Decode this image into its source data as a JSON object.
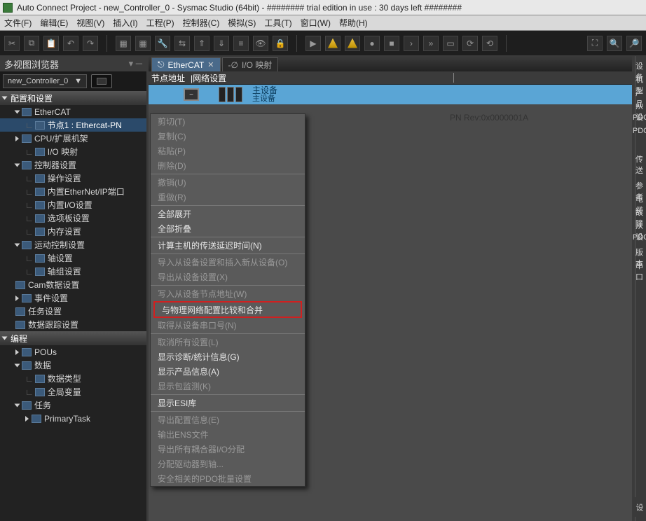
{
  "title": "Auto Connect Project - new_Controller_0 - Sysmac Studio (64bit) - ######## trial edition in use : 30 days left ########",
  "menu": {
    "file": "文件(F)",
    "edit": "编辑(E)",
    "view": "视图(V)",
    "insert": "插入(I)",
    "project": "工程(P)",
    "controller": "控制器(C)",
    "sim": "模拟(S)",
    "tool": "工具(T)",
    "window": "窗口(W)",
    "help": "帮助(H)"
  },
  "leftPane": {
    "title": "多视图浏览器",
    "dash": "▾",
    "controller": "new_Controller_0"
  },
  "tree": {
    "g1": "配置和设置",
    "items": [
      {
        "ind": 14,
        "tri": "d",
        "ico": 1,
        "label": "EtherCAT"
      },
      {
        "ind": 28,
        "tri": "",
        "ico": 1,
        "label": "节点1 : Ethercat-PN",
        "sel": true,
        "pipe": 1
      },
      {
        "ind": 14,
        "tri": "r",
        "ico": 1,
        "label": "CPU/扩展机架"
      },
      {
        "ind": 28,
        "tri": "",
        "ico": 1,
        "label": "I/O 映射",
        "pipe": 1
      },
      {
        "ind": 14,
        "tri": "d",
        "ico": 1,
        "label": "控制器设置"
      },
      {
        "ind": 28,
        "tri": "",
        "ico": 1,
        "label": "操作设置",
        "pipe": 1
      },
      {
        "ind": 28,
        "tri": "",
        "ico": 1,
        "label": "内置EtherNet/IP端口",
        "pipe": 1
      },
      {
        "ind": 28,
        "tri": "",
        "ico": 1,
        "label": "内置I/O设置",
        "pipe": 1
      },
      {
        "ind": 28,
        "tri": "",
        "ico": 1,
        "label": "选项板设置",
        "pipe": 1
      },
      {
        "ind": 28,
        "tri": "",
        "ico": 1,
        "label": "内存设置",
        "pipe": 1
      },
      {
        "ind": 14,
        "tri": "d",
        "ico": 1,
        "label": "运动控制设置"
      },
      {
        "ind": 28,
        "tri": "",
        "ico": 1,
        "label": "轴设置",
        "pipe": 1
      },
      {
        "ind": 28,
        "tri": "",
        "ico": 1,
        "label": "轴组设置",
        "pipe": 1
      },
      {
        "ind": 14,
        "tri": "",
        "ico": 1,
        "label": "Cam数据设置"
      },
      {
        "ind": 14,
        "tri": "r",
        "ico": 1,
        "label": "事件设置"
      },
      {
        "ind": 14,
        "tri": "",
        "ico": 1,
        "label": "任务设置"
      },
      {
        "ind": 14,
        "tri": "",
        "ico": 1,
        "label": "数据跟踪设置"
      }
    ],
    "g2": "编程",
    "items2": [
      {
        "ind": 14,
        "tri": "r",
        "ico": 1,
        "label": "POUs"
      },
      {
        "ind": 14,
        "tri": "d",
        "ico": 1,
        "label": "数据"
      },
      {
        "ind": 28,
        "tri": "",
        "ico": 1,
        "label": "数据类型",
        "pipe": 1
      },
      {
        "ind": 28,
        "tri": "",
        "ico": 1,
        "label": "全局变量",
        "pipe": 1
      },
      {
        "ind": 14,
        "tri": "d",
        "ico": 1,
        "label": "任务"
      },
      {
        "ind": 28,
        "tri": "r",
        "ico": 1,
        "label": "PrimaryTask"
      }
    ]
  },
  "tabs": {
    "t1": "EtherCAT",
    "t2": "I/O 映射"
  },
  "subhdr": {
    "a": "节点地址",
    "b": "|网络设置"
  },
  "device": {
    "main": "主设备",
    "sub": "主设备",
    "rev": "PN Rev:0x0000001A",
    "minus": "−"
  },
  "rightLabels": [
    "设备",
    "机型",
    "产品",
    "从设",
    "PDC",
    "PDC",
    "",
    "传送",
    "",
    "参考",
    "电缆",
    "故障",
    "从设",
    "PDC",
    "版本",
    "串口"
  ],
  "statusCorner": "设",
  "ctx": [
    {
      "t": "剪切(T)",
      "d": 1
    },
    {
      "t": "复制(C)",
      "d": 1
    },
    {
      "t": "粘贴(P)",
      "d": 1
    },
    {
      "t": "删除(D)",
      "d": 1
    },
    {
      "sep": 1
    },
    {
      "t": "撤销(U)",
      "d": 1
    },
    {
      "t": "重做(R)",
      "d": 1
    },
    {
      "sep": 1
    },
    {
      "t": "全部展开"
    },
    {
      "t": "全部折叠"
    },
    {
      "sep": 1
    },
    {
      "t": "计算主机的传送延迟时间(N)"
    },
    {
      "sep": 1
    },
    {
      "t": "导入从设备设置和插入新从设备(O)",
      "d": 1
    },
    {
      "t": "导出从设备设置(X)",
      "d": 1
    },
    {
      "sep": 1
    },
    {
      "t": "写入从设备节点地址(W)",
      "d": 1
    },
    {
      "t": "与物理网络配置比较和合并",
      "box": 1
    },
    {
      "t": "取得从设备串口号(N)",
      "d": 1
    },
    {
      "sep": 1
    },
    {
      "t": "取消所有设置(L)",
      "d": 1
    },
    {
      "t": "显示诊断/统计信息(G)"
    },
    {
      "t": "显示产品信息(A)"
    },
    {
      "t": "显示包监测(K)",
      "d": 1
    },
    {
      "sep": 1
    },
    {
      "t": "显示ESI库"
    },
    {
      "sep": 1
    },
    {
      "t": "导出配置信息(E)",
      "d": 1
    },
    {
      "t": "输出ENS文件",
      "d": 1
    },
    {
      "t": "导出所有耦合器I/O分配",
      "d": 1
    },
    {
      "t": "分配驱动器到轴...",
      "d": 1
    },
    {
      "t": "安全相关的PDO批量设置",
      "d": 1
    }
  ]
}
